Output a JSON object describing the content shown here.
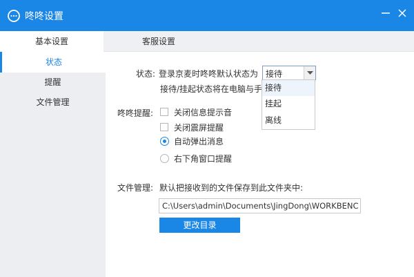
{
  "window": {
    "title": "咚咚设置",
    "accent_color": "#1a86e6",
    "logo_icon": "chat-bubble-icon",
    "minimize_icon": "minimize-icon",
    "close_icon": "close-icon"
  },
  "tabs": [
    {
      "label": "基本设置",
      "active": true
    },
    {
      "label": "客服设置",
      "active": false
    }
  ],
  "sidebar": {
    "items": [
      {
        "label": "状态",
        "active": true
      },
      {
        "label": "提醒",
        "active": false
      },
      {
        "label": "文件管理",
        "active": false
      }
    ]
  },
  "status": {
    "label": "状态:",
    "description": "登录京麦时咚咚默认状态为",
    "selected": "接待",
    "note": "接待/挂起状态将在电脑与手",
    "options": [
      "接待",
      "挂起",
      "离线"
    ]
  },
  "reminder": {
    "label": "咚咚提醒:",
    "options": [
      {
        "label": "关闭信息提示音",
        "type": "checkbox",
        "checked": false
      },
      {
        "label": "关闭震屏提醒",
        "type": "checkbox",
        "checked": false
      },
      {
        "label": "自动弹出消息",
        "type": "radio",
        "checked": true
      },
      {
        "label": "右下角窗口提醒",
        "type": "radio",
        "checked": false
      }
    ]
  },
  "file": {
    "label": "文件管理:",
    "description": "默认把接收到的文件保存到此文件夹中:",
    "path": "C:\\Users\\admin\\Documents\\JingDong\\WORKBENC",
    "change_button": "更改目录"
  }
}
